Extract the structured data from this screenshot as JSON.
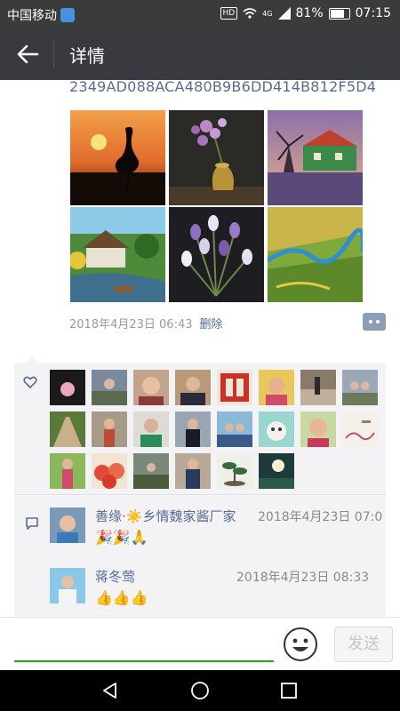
{
  "status_bar": {
    "carrier": "中国移动",
    "network": "4G",
    "battery": "81%",
    "battery_level": 0.81,
    "time": "07:15",
    "hd_label": "HD"
  },
  "header": {
    "title": "详情",
    "back_icon": "arrow-left-icon"
  },
  "post": {
    "hash_text": "2349AD088ACA480B9B6DD414B812F5D4",
    "photos": [
      {
        "name": "heron-sunset-photo"
      },
      {
        "name": "purple-orchid-vase-photo"
      },
      {
        "name": "windmill-house-photo"
      },
      {
        "name": "village-canal-photo"
      },
      {
        "name": "tulips-bouquet-photo"
      },
      {
        "name": "river-fields-photo"
      }
    ],
    "date": "2018年4月23日 06:43",
    "delete_label": "删除",
    "more_icon": "comment-more-icon"
  },
  "likes": {
    "icon": "heart-icon",
    "avatar_count": 22
  },
  "comments": {
    "icon": "comment-icon",
    "items": [
      {
        "name": "善缘·☀️乡情魏家酱厂家",
        "time": "2018年4月23日 07:0",
        "content": "🎉🎉🙏"
      },
      {
        "name": "蒋冬莺",
        "time": "2018年4月23日 08:33",
        "content": "👍👍👍"
      }
    ]
  },
  "input": {
    "value": "",
    "emoji_icon": "smiley-icon",
    "send_label": "发送"
  },
  "nav": {
    "back": "triangle-back-icon",
    "home": "circle-home-icon",
    "recents": "square-recents-icon"
  },
  "colors": {
    "link": "#576b95",
    "accent_green": "#1aad19",
    "appbar": "#393a3f",
    "status": "#3b3b3b"
  }
}
